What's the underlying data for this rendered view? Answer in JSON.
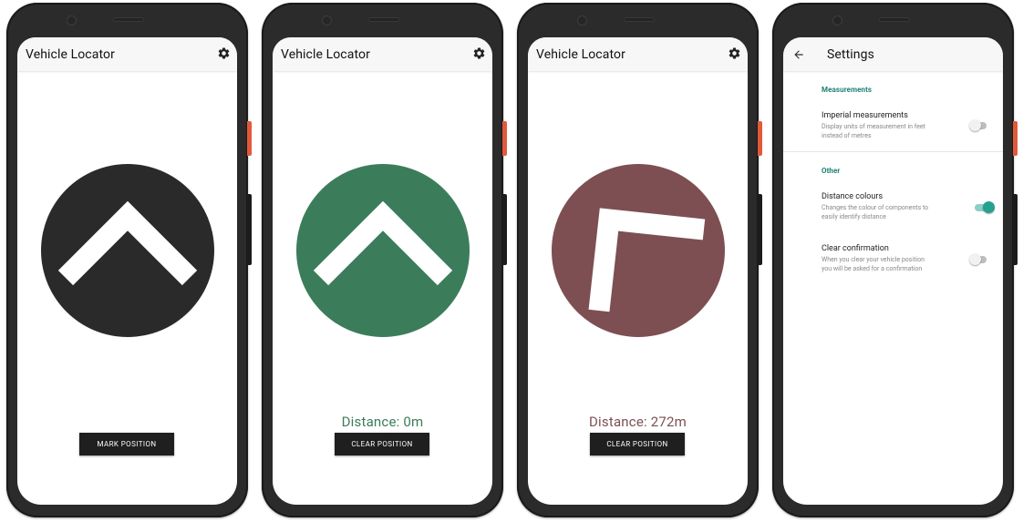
{
  "screens": [
    {
      "app_title": "Vehicle Locator",
      "circle_color": "#2a2a2a",
      "arrow": "chevron-up",
      "distance": "",
      "button_label": "MARK POSITION"
    },
    {
      "app_title": "Vehicle Locator",
      "circle_color": "#3b7d5a",
      "arrow": "chevron-up",
      "distance": "Distance: 0m",
      "distance_color": "#3b7d5a",
      "button_label": "CLEAR POSITION"
    },
    {
      "app_title": "Vehicle Locator",
      "circle_color": "#7d4f52",
      "arrow": "chevron-up-left",
      "distance": "Distance: 272m",
      "distance_color": "#7d4f52",
      "button_label": "CLEAR POSITION"
    }
  ],
  "settings": {
    "title": "Settings",
    "sections": [
      {
        "title": "Measurements",
        "items": [
          {
            "title": "Imperial measurements",
            "summary_lines": [
              "Display units of measurement in feet",
              "instead of metres"
            ],
            "enabled": false
          }
        ]
      },
      {
        "title": "Other",
        "items": [
          {
            "title": "Distance colours",
            "summary_lines": [
              "Changes the colour of components to",
              "easily identify distance"
            ],
            "enabled": true
          },
          {
            "title": "Clear confirmation",
            "summary_lines": [
              "When you clear your vehicle position",
              "you will be asked for a confirmation"
            ],
            "enabled": false
          }
        ]
      }
    ]
  },
  "icons": {
    "settings": "gear-icon",
    "back": "arrow-back-icon",
    "direction": "chevron-icon"
  },
  "colors": {
    "accent": "#26a08f",
    "section_title": "#1f7f73",
    "phone_frame": "#2b2b2b",
    "button": "#1f1f1f"
  }
}
